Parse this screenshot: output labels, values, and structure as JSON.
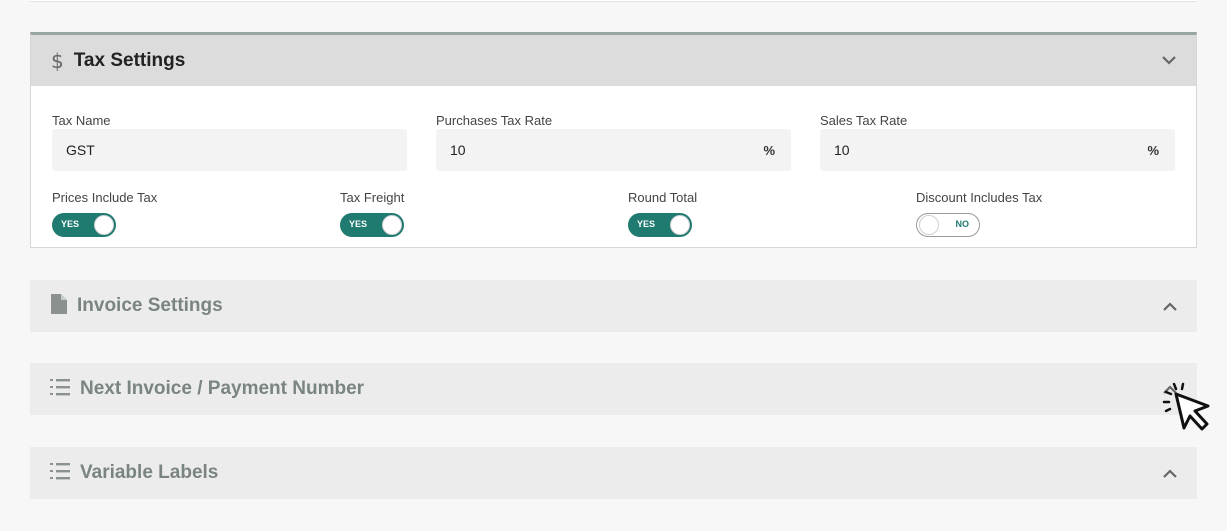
{
  "tax_settings": {
    "title": "Tax Settings",
    "icon": "dollar-icon",
    "tax_name": {
      "label": "Tax Name",
      "value": "GST"
    },
    "purchases_tax_rate": {
      "label": "Purchases Tax Rate",
      "value": "10",
      "suffix": "%"
    },
    "sales_tax_rate": {
      "label": "Sales Tax Rate",
      "value": "10",
      "suffix": "%"
    },
    "prices_include_tax": {
      "label": "Prices Include Tax",
      "state": "YES"
    },
    "tax_freight": {
      "label": "Tax Freight",
      "state": "YES"
    },
    "round_total": {
      "label": "Round Total",
      "state": "YES"
    },
    "discount_includes_tax": {
      "label": "Discount Includes Tax",
      "state": "NO"
    }
  },
  "sections": {
    "invoice_settings": {
      "title": "Invoice Settings",
      "icon": "document-icon"
    },
    "next_invoice": {
      "title": "Next Invoice / Payment Number",
      "icon": "numbered-list-icon"
    },
    "variable_labels": {
      "title": "Variable Labels",
      "icon": "numbered-list-icon"
    }
  },
  "colors": {
    "toggle_on": "#1f7a6f",
    "header_active": "#dcdcdc",
    "header_collapsed": "#ececec",
    "collapsed_title": "#7a8580"
  }
}
